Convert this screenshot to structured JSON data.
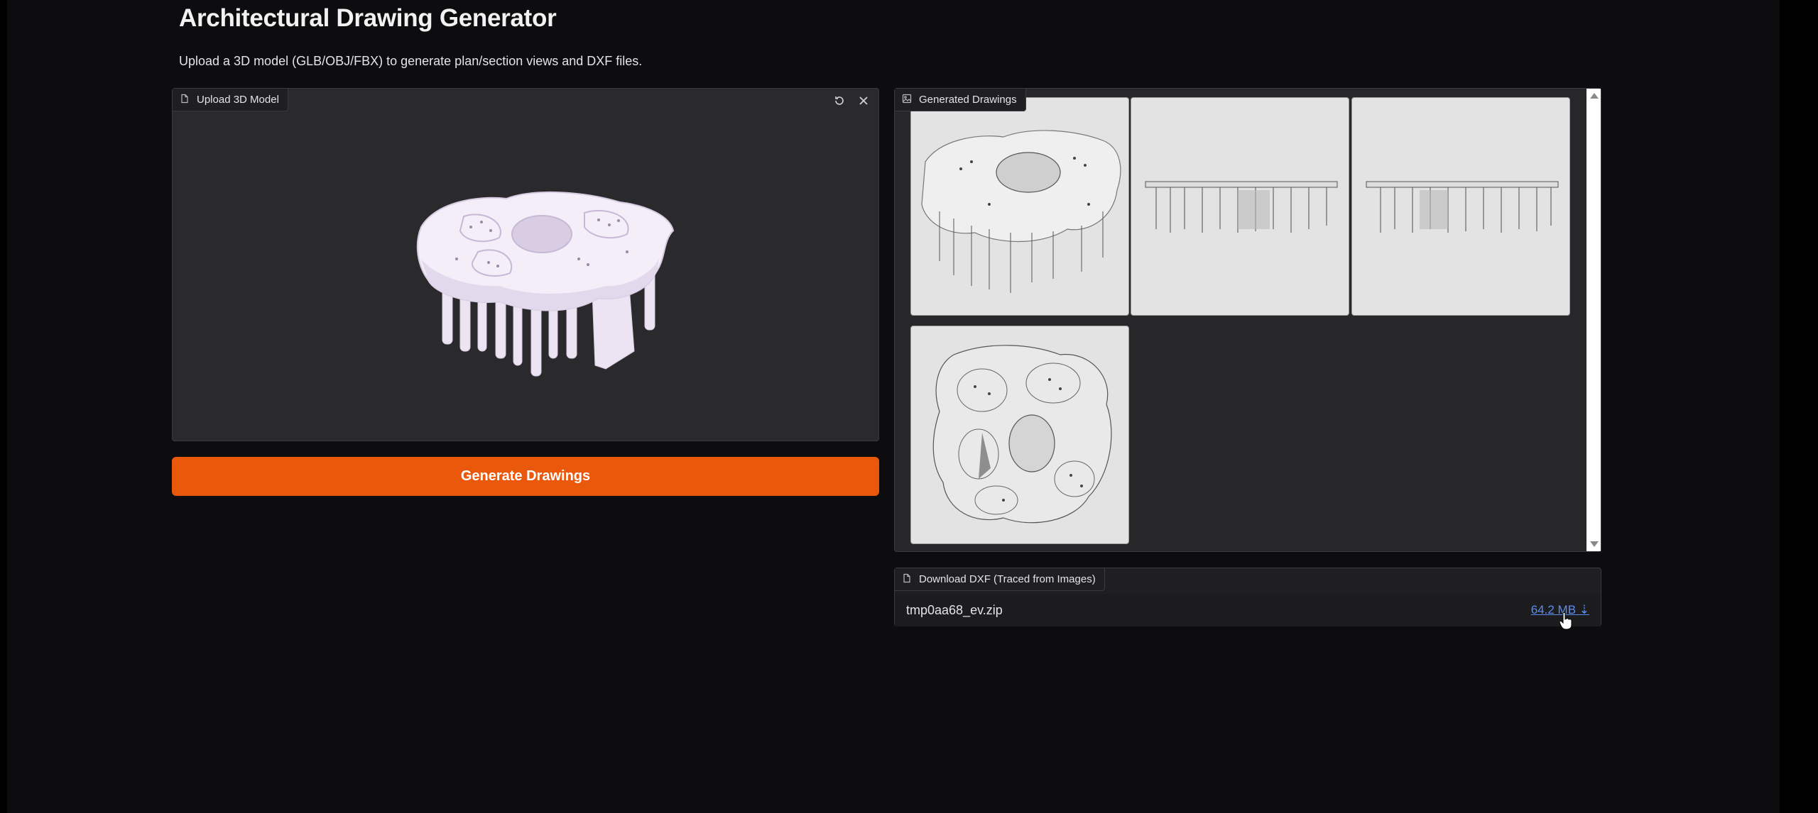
{
  "page": {
    "title": "Architectural Drawing Generator",
    "subtitle": "Upload a 3D model (GLB/OBJ/FBX) to generate plan/section views and DXF files."
  },
  "upload": {
    "label": "Upload 3D Model",
    "label_icon": "file-icon",
    "controls": [
      {
        "name": "reset-view-icon"
      },
      {
        "name": "close-icon"
      }
    ]
  },
  "actions": {
    "generate_label": "Generate Drawings"
  },
  "gallery": {
    "label": "Generated Drawings",
    "label_icon": "image-icon",
    "images": [
      {
        "view": "isometric"
      },
      {
        "view": "elevation"
      },
      {
        "view": "section"
      },
      {
        "view": "plan"
      }
    ]
  },
  "download": {
    "label": "Download DXF (Traced from Images)",
    "label_icon": "file-icon",
    "file_name": "tmp0aa68_ev.zip",
    "file_size": "64.2 MB ⇣"
  },
  "colors": {
    "accent": "#ea580c",
    "background": "#0d0d10",
    "panel": "#27272a",
    "link": "#5b8def"
  }
}
